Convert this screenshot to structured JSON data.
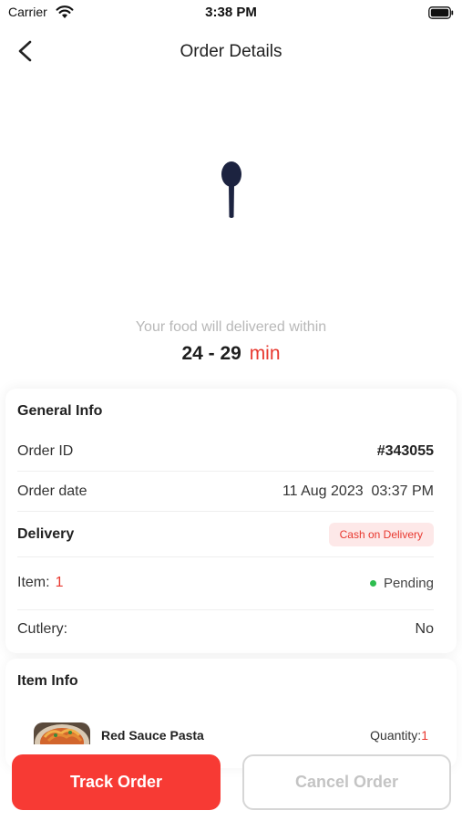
{
  "status_bar": {
    "carrier": "Carrier",
    "time": "3:38 PM"
  },
  "nav": {
    "title": "Order Details"
  },
  "delivery": {
    "message": "Your food will delivered within",
    "eta": "24 - 29",
    "eta_unit": "min"
  },
  "general_info": {
    "title": "General Info",
    "order_id_label": "Order ID",
    "order_id": "#343055",
    "order_date_label": "Order date",
    "order_date": "11 Aug 2023  03:37 PM",
    "delivery_label": "Delivery",
    "payment_method": "Cash on Delivery",
    "item_label": "Item:",
    "item_count": "1",
    "order_status": "Pending",
    "cutlery_label": "Cutlery:",
    "cutlery_value": "No"
  },
  "item_info": {
    "title": "Item Info",
    "items": [
      {
        "name": "Red Sauce Pasta",
        "quantity_label": "Quantity:",
        "quantity": "1"
      }
    ]
  },
  "actions": {
    "track": "Track Order",
    "cancel": "Cancel Order"
  },
  "colors": {
    "accent": "#f73a34",
    "status_green": "#2ebd4f",
    "spoon": "#1c2340"
  },
  "icons": {
    "back": "chevron-left-icon",
    "hero": "spoon-icon",
    "wifi": "wifi-icon",
    "battery": "battery-icon"
  }
}
